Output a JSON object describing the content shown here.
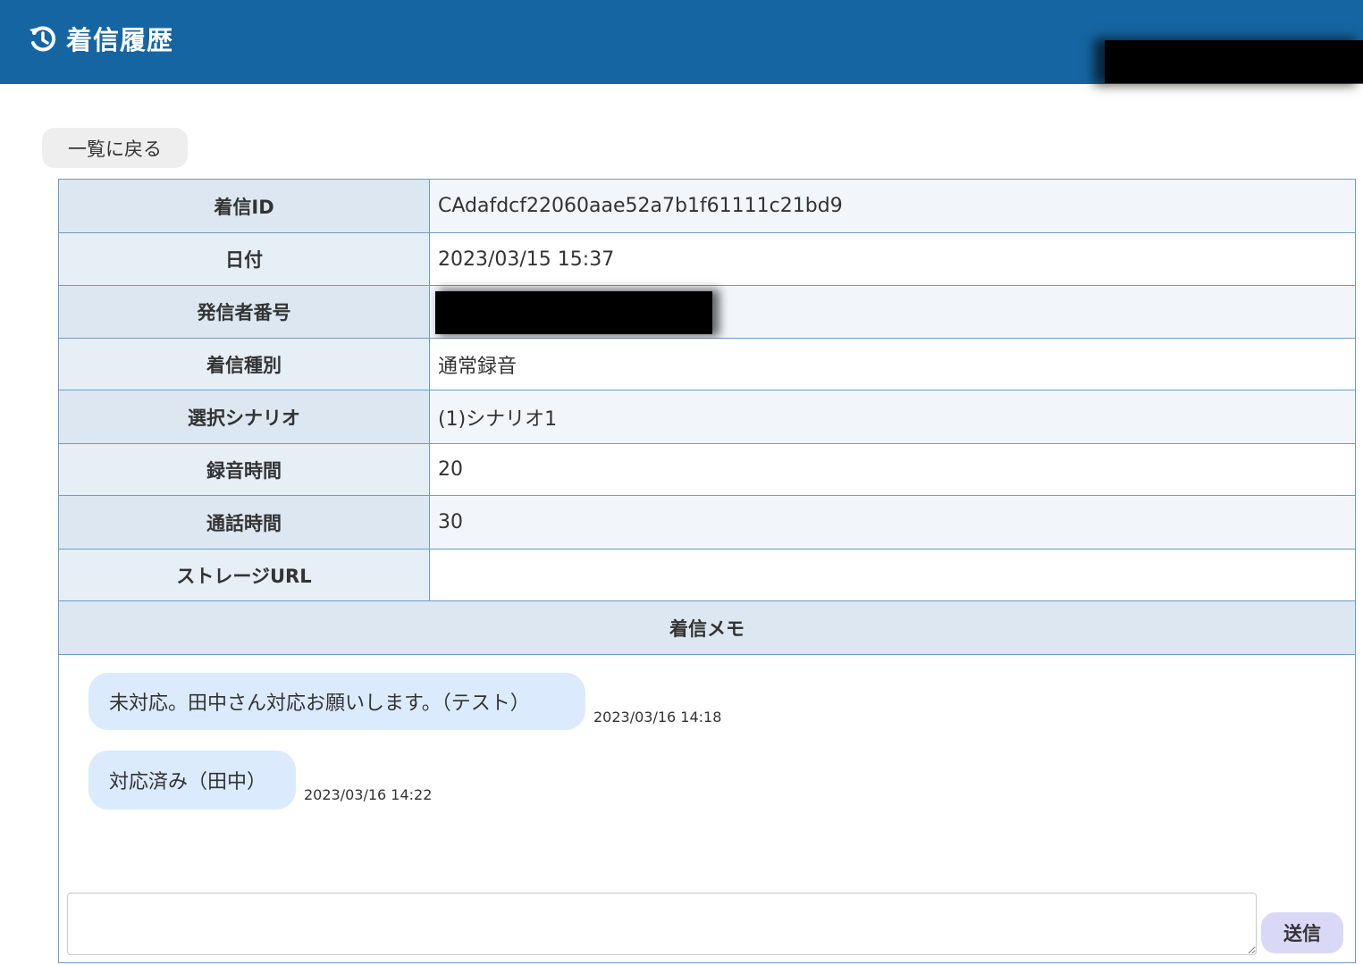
{
  "header": {
    "title": "着信履歴",
    "icon": "history-icon",
    "brand_color": "#1565a3"
  },
  "back_button_label": "一覧に戻る",
  "details": [
    {
      "label": "着信ID",
      "value": "CAdafdcf22060aae52a7b1f61111c21bd9"
    },
    {
      "label": "日付",
      "value": "2023/03/15 15:37"
    },
    {
      "label": "発信者番号",
      "value": ""
    },
    {
      "label": "着信種別",
      "value": "通常録音"
    },
    {
      "label": "選択シナリオ",
      "value": "(1)シナリオ1"
    },
    {
      "label": "録音時間",
      "value": "20"
    },
    {
      "label": "通話時間",
      "value": "30"
    },
    {
      "label": "ストレージURL",
      "value": ""
    }
  ],
  "memo": {
    "title": "着信メモ",
    "messages": [
      {
        "text": "未対応。田中さん対応お願いします。（テスト）",
        "time": "2023/03/16 14:18"
      },
      {
        "text": "対応済み（田中）",
        "time": "2023/03/16 14:22"
      }
    ],
    "input_value": "",
    "send_label": "送信"
  }
}
